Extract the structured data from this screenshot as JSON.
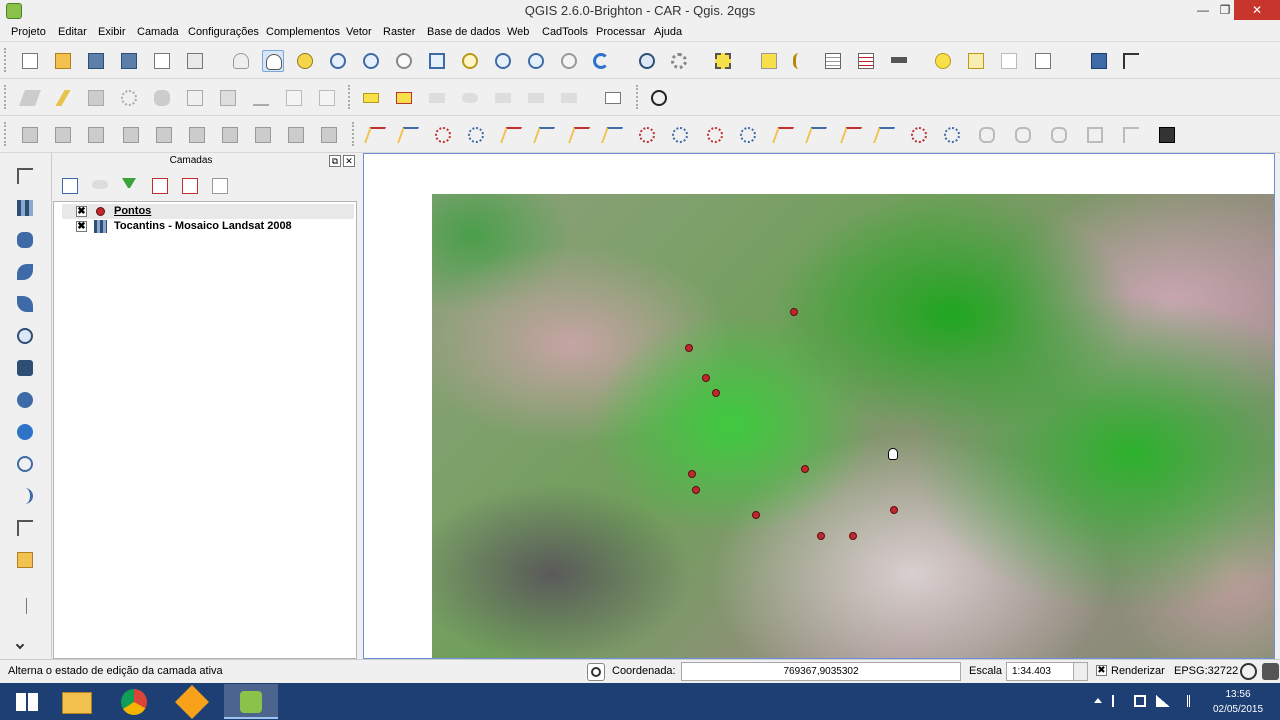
{
  "window": {
    "title": "QGIS 2.6.0-Brighton - CAR - Qgis. 2qgs",
    "minimize": "—",
    "maximize": "❐",
    "close": "✕"
  },
  "menu": [
    "Projeto",
    "Editar",
    "Exibir",
    "Camada",
    "Configurações",
    "Complementos",
    "Vetor",
    "Raster",
    "Base de dados",
    "Web",
    "CadTools",
    "Processar",
    "Ajuda"
  ],
  "panel": {
    "title": "Camadas",
    "float_btn": "⧉",
    "close_btn": "✕",
    "layers": [
      {
        "name": "Pontos",
        "checked": "✖"
      },
      {
        "name": "Tocantins - Mosaico Landsat 2008",
        "checked": "✖"
      }
    ]
  },
  "status": {
    "message": "Alterna o estado de edição da camada ativa",
    "coord_label": "Coordenada:",
    "coord_value": "769367,9035302",
    "scale_label": "Escala",
    "scale_value": "1:34.403",
    "render_check": "✖",
    "render_label": "Renderizar",
    "epsg": "EPSG:32722"
  },
  "taskbar": {
    "time": "13:56",
    "date": "02/05/2015"
  },
  "colors": {
    "point": "#c0282d",
    "map_border": "#6d8fd8",
    "taskbar": "#1e3f73"
  }
}
